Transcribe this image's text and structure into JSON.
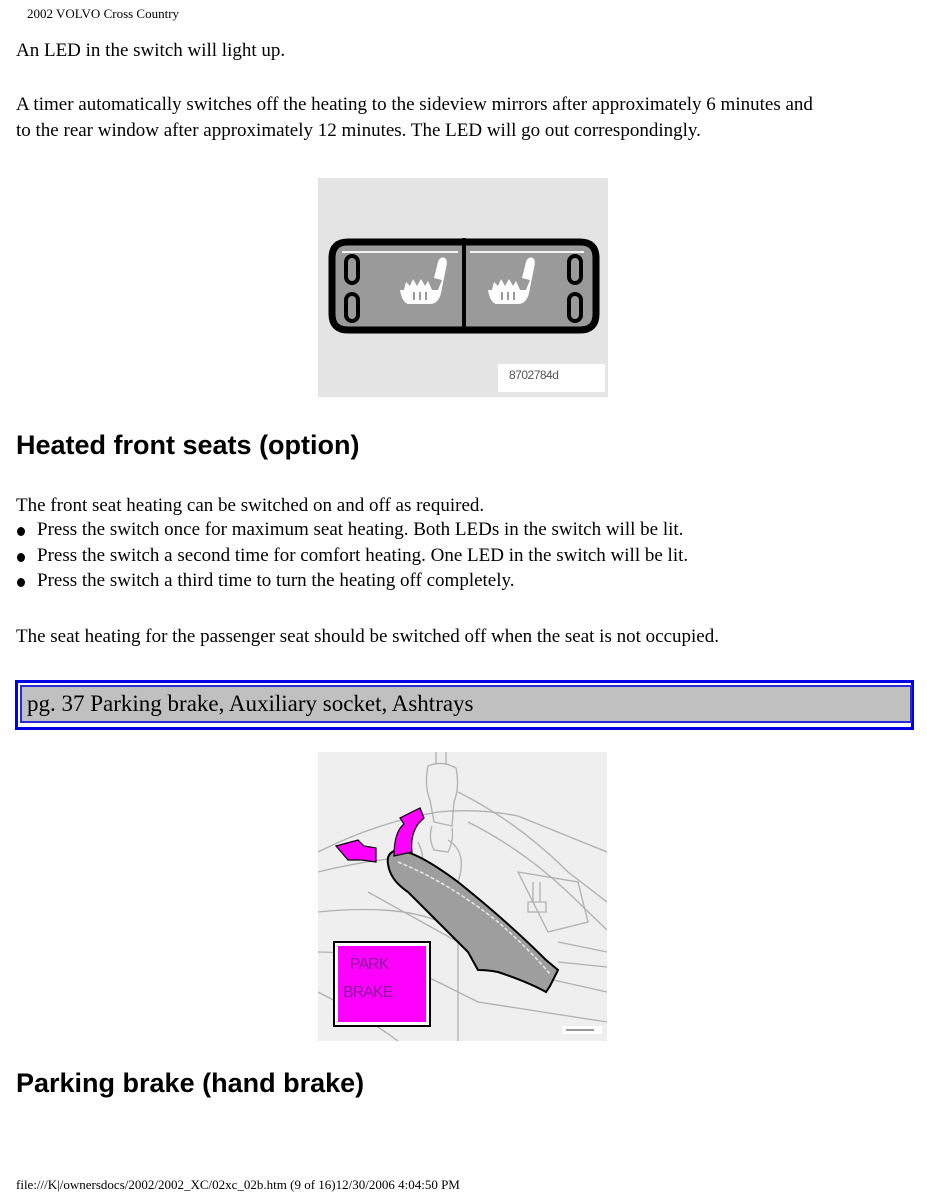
{
  "page": {
    "header": "2002 VOLVO Cross Country",
    "footer": "file:///K|/ownersdocs/2002/2002_XC/02xc_02b.htm (9 of 16)12/30/2006 4:04:50 PM"
  },
  "intro": {
    "led_text": "An LED in the switch will light up.",
    "timer_line1": "A timer automatically switches off the heating to the sideview mirrors after approximately 6 minutes and",
    "timer_line2": "to the rear window after approximately 12 minutes. The LED will go out correspondingly."
  },
  "figure_seat_switch": {
    "caption_code": "8702784d",
    "icons": [
      "seat-heater-icon-left",
      "seat-heater-icon-right"
    ],
    "colors": {
      "background": "#e4e4e4",
      "switch_face": "#9a9a9a",
      "outline": "#000000",
      "glyph": "#ffffff"
    }
  },
  "heated_seats": {
    "heading": "Heated front seats (option)",
    "intro": "The front seat heating can be switched on and off as required.",
    "bullets": [
      "Press the switch once for maximum seat heating. Both LEDs in the switch will be lit.",
      "Press the switch a second time for comfort heating. One LED in the switch will be lit.",
      "Press the switch a third time to turn the heating off completely."
    ],
    "note": "The seat heating for the passenger seat should be switched off when the seat is not occupied."
  },
  "page_nav": {
    "label": "pg. 37 Parking brake, Auxiliary socket, Ashtrays",
    "colors": {
      "border": "#0000e0",
      "fill": "#c0c0c0"
    }
  },
  "figure_parking_brake": {
    "label_line1": "PARK",
    "label_line2": "BRAKE",
    "colors": {
      "label_fill": "#ff00ff",
      "label_text": "#8a1a9a",
      "arrow": "#ff00ff",
      "lever": "#9e9e9e"
    }
  },
  "parking_brake": {
    "heading": "Parking brake (hand brake)"
  }
}
